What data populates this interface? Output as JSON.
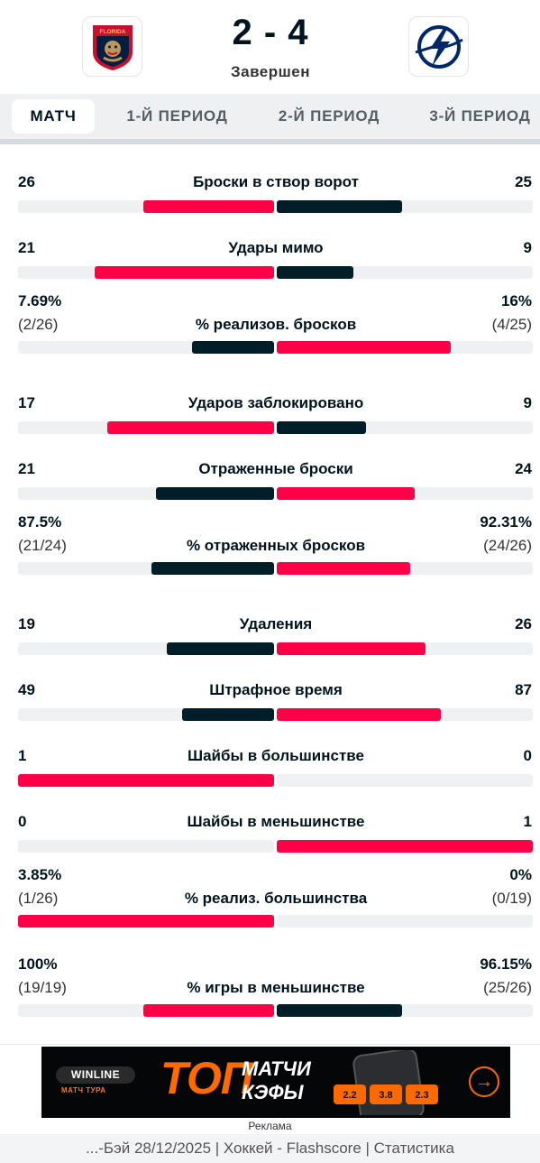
{
  "header": {
    "score": "2 - 4",
    "status": "Завершен",
    "home_logo_text": "FLORIDA",
    "colors": {
      "home_logo_red": "#c8102e",
      "home_logo_navy": "#041e42",
      "away_logo_blue": "#002868"
    }
  },
  "tabs": [
    {
      "label": "МАТЧ",
      "active": true
    },
    {
      "label": "1-Й ПЕРИОД",
      "active": false
    },
    {
      "label": "2-Й ПЕРИОД",
      "active": false
    },
    {
      "label": "3-Й ПЕРИОД",
      "active": false
    }
  ],
  "colors": {
    "home_bar": "#ff0046",
    "away_bar": "#001e28",
    "track": "#eef0f1"
  },
  "stats": [
    {
      "label": "Броски в створ ворот",
      "home": "26",
      "away": "25",
      "home_ratio": 0.51,
      "away_ratio": 0.49,
      "home_color": "#ff0046",
      "away_color": "#001e28"
    },
    {
      "label": "Удары мимо",
      "home": "21",
      "away": "9",
      "home_ratio": 0.7,
      "away_ratio": 0.3,
      "home_color": "#ff0046",
      "away_color": "#001e28"
    },
    {
      "label": "% реализов. бросков",
      "home": "7.69%",
      "home_sub": "(2/26)",
      "away": "16%",
      "away_sub": "(4/25)",
      "home_ratio": 0.32,
      "away_ratio": 0.68,
      "home_color": "#001e28",
      "away_color": "#ff0046"
    },
    {
      "label": "Ударов заблокировано",
      "home": "17",
      "away": "9",
      "home_ratio": 0.65,
      "away_ratio": 0.35,
      "home_color": "#ff0046",
      "away_color": "#001e28"
    },
    {
      "label": "Отраженные броски",
      "home": "21",
      "away": "24",
      "home_ratio": 0.46,
      "away_ratio": 0.54,
      "home_color": "#001e28",
      "away_color": "#ff0046"
    },
    {
      "label": "% отраженных бросков",
      "home": "87.5%",
      "home_sub": "(21/24)",
      "away": "92.31%",
      "away_sub": "(24/26)",
      "home_ratio": 0.48,
      "away_ratio": 0.52,
      "home_color": "#001e28",
      "away_color": "#ff0046"
    },
    {
      "label": "Удаления",
      "home": "19",
      "away": "26",
      "home_ratio": 0.42,
      "away_ratio": 0.58,
      "home_color": "#001e28",
      "away_color": "#ff0046"
    },
    {
      "label": "Штрафное время",
      "home": "49",
      "away": "87",
      "home_ratio": 0.36,
      "away_ratio": 0.64,
      "home_color": "#001e28",
      "away_color": "#ff0046"
    },
    {
      "label": "Шайбы в большинстве",
      "home": "1",
      "away": "0",
      "home_ratio": 1.0,
      "away_ratio": 0.0,
      "home_color": "#ff0046",
      "away_color": "#001e28"
    },
    {
      "label": "Шайбы в меньшинстве",
      "home": "0",
      "away": "1",
      "home_ratio": 0.0,
      "away_ratio": 1.0,
      "home_color": "#001e28",
      "away_color": "#ff0046"
    },
    {
      "label": "% реализ. большинства",
      "home": "3.85%",
      "home_sub": "(1/26)",
      "away": "0%",
      "away_sub": "(0/19)",
      "home_ratio": 1.0,
      "away_ratio": 0.0,
      "home_color": "#ff0046",
      "away_color": "#001e28"
    },
    {
      "label": "% игры в меньшинстве",
      "home": "100%",
      "home_sub": "(19/19)",
      "away": "96.15%",
      "away_sub": "(25/26)",
      "home_ratio": 0.51,
      "away_ratio": 0.49,
      "home_color": "#ff0046",
      "away_color": "#001e28"
    }
  ],
  "ad": {
    "brand": "WINLINE",
    "brand_sub": "МАТЧ ТУРА",
    "headline": "ТОП",
    "line1": "МАТЧИ",
    "line2": "КЭФЫ",
    "phone_odds": [
      "2.2",
      "3.8",
      "2.3"
    ],
    "label": "Реклама"
  },
  "footer": {
    "text": "...-Бэй 28/12/2025 | Хоккей - Flashscore | Статистика"
  }
}
